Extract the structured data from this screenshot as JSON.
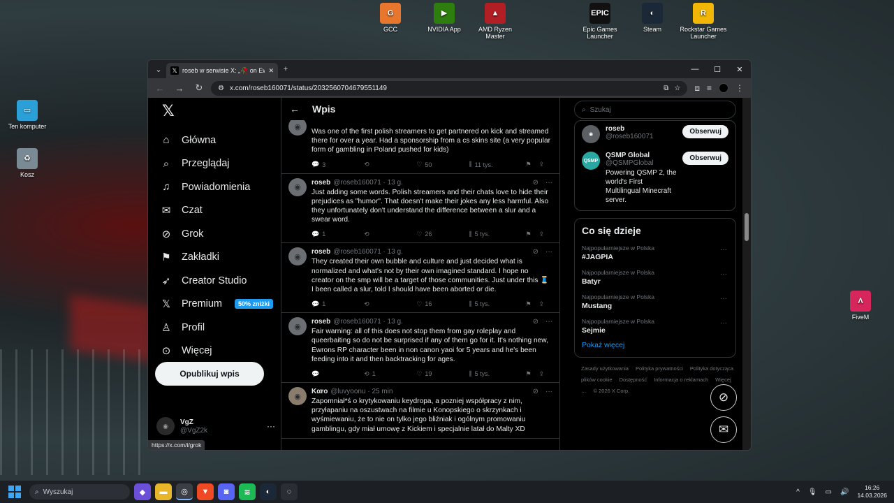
{
  "desktop": {
    "icons_top": [
      {
        "label": "GCC",
        "color": "#e8762c"
      },
      {
        "label": "NVIDIA App",
        "color": "#2e7d0f"
      },
      {
        "label": "AMD Ryzen Master",
        "color": "#b11f24"
      },
      {
        "label": "Epic Games\nLauncher",
        "color": "#111111"
      },
      {
        "label": "Steam",
        "color": "#1b2838"
      },
      {
        "label": "Rockstar Games\nLauncher",
        "color": "#f2b705"
      }
    ],
    "icon_computer": "Ten komputer",
    "icon_trash": "Kosz",
    "icon_fivem": "FiveM"
  },
  "browser": {
    "tab_title": "roseb w serwisie X: „🥀 on Ewr",
    "url": "x.com/roseb160071/status/2032560704679551149",
    "status_url": "https://x.com/i/grok"
  },
  "x": {
    "nav": [
      {
        "icon": "home",
        "label": "Główna"
      },
      {
        "icon": "search",
        "label": "Przeglądaj"
      },
      {
        "icon": "bell",
        "label": "Powiadomienia"
      },
      {
        "icon": "mail",
        "label": "Czat"
      },
      {
        "icon": "grok",
        "label": "Grok"
      },
      {
        "icon": "bookmark",
        "label": "Zakładki"
      },
      {
        "icon": "rocket",
        "label": "Creator Studio"
      },
      {
        "icon": "x",
        "label": "Premium",
        "badge": "50% zniżki"
      },
      {
        "icon": "person",
        "label": "Profil"
      },
      {
        "icon": "more",
        "label": "Więcej"
      }
    ],
    "post_button": "Opublikuj wpis",
    "user": {
      "name": "VgZ",
      "handle": "@VgZ2k"
    },
    "center_title": "Wpis",
    "tweets": [
      {
        "name": "",
        "handle": "",
        "time": "",
        "text": "Was one of the first polish streamers to get partnered on kick and streamed there for over a year. Had a sponsorship from a cs skins site (a very popular form of gambling in Poland pushed for kids)",
        "replies": "3",
        "reposts": "",
        "likes": "50",
        "views": "11 tys."
      },
      {
        "name": "roseb",
        "handle": "@roseb160071 · 13 g.",
        "time": "",
        "text": "Just adding some words. Polish streamers and their chats love to hide their prejudices as \"humor\". That doesn't make their jokes any less harmful. Also they unfortunately don't understand the difference between a slur and a swear word.",
        "replies": "1",
        "reposts": "",
        "likes": "26",
        "views": "5 tys."
      },
      {
        "name": "roseb",
        "handle": "@roseb160071 · 13 g.",
        "time": "",
        "text": "They created their own bubble and culture and just decided what is normalized and what's not by their own imagined standard. I hope no creator on the smp will be a target of those communities. Just under this 🧵 I been called a slur, told I should have been aborted or die.",
        "replies": "1",
        "reposts": "",
        "likes": "16",
        "views": "5 tys."
      },
      {
        "name": "roseb",
        "handle": "@roseb160071 · 13 g.",
        "time": "",
        "text": "Fair warning: all of this does not stop them from gay roleplay and queerbaiting so do not be surprised if any of them go for it. It's nothing new, Ewrons RP character been in non canon yaoi for 5 years and he's been feeding into it and then backtracking for ages.",
        "replies": "",
        "reposts": "1",
        "likes": "19",
        "views": "5 tys."
      },
      {
        "name": "Kαro",
        "handle": "@luvyoonu · 25 min",
        "time": "",
        "text": "Zapomniał*ś o krytykowaniu keydropa, a pozniej współpracy z nim, przyłapaniu na oszustwach na filmie u Konopskiego o skrzynkach i wyśmiewaniu, że to nie on tylko jego bliźniak i ogólnym promowaniu gamblingu, gdy miał umowę z Kickiem i specjalnie latał do Malty XD",
        "replies": "",
        "reposts": "",
        "likes": "",
        "views": ""
      }
    ],
    "search_placeholder": "Szukaj",
    "follow": [
      {
        "name": "roseb",
        "handle": "@roseb160071",
        "bio": "",
        "button": "Obserwuj"
      },
      {
        "name": "QSMP Global",
        "handle": "@QSMPGlobal",
        "bio": "Powering QSMP 2, the world's First Multilingual Minecraft server.",
        "button": "Obserwuj"
      }
    ],
    "trends_title": "Co się dzieje",
    "trends": [
      {
        "category": "Najpopularniejsze w Polska",
        "name": "#JAGPIA"
      },
      {
        "category": "Najpopularniejsze w Polska",
        "name": "Batyr"
      },
      {
        "category": "Najpopularniejsze w Polska",
        "name": "Mustang"
      },
      {
        "category": "Najpopularniejsze w Polska",
        "name": "Sejmie"
      }
    ],
    "show_more": "Pokaż więcej",
    "footer_links": [
      "Zasady użytkowania",
      "Polityka prywatności",
      "Polityka dotycząca plików cookie",
      "Dostępność",
      "Informacja o reklamach",
      "Więcej …",
      "© 2026 X Corp."
    ]
  },
  "taskbar": {
    "search": "Wyszukaj",
    "time": "16:26",
    "date": "14.03.2026"
  }
}
